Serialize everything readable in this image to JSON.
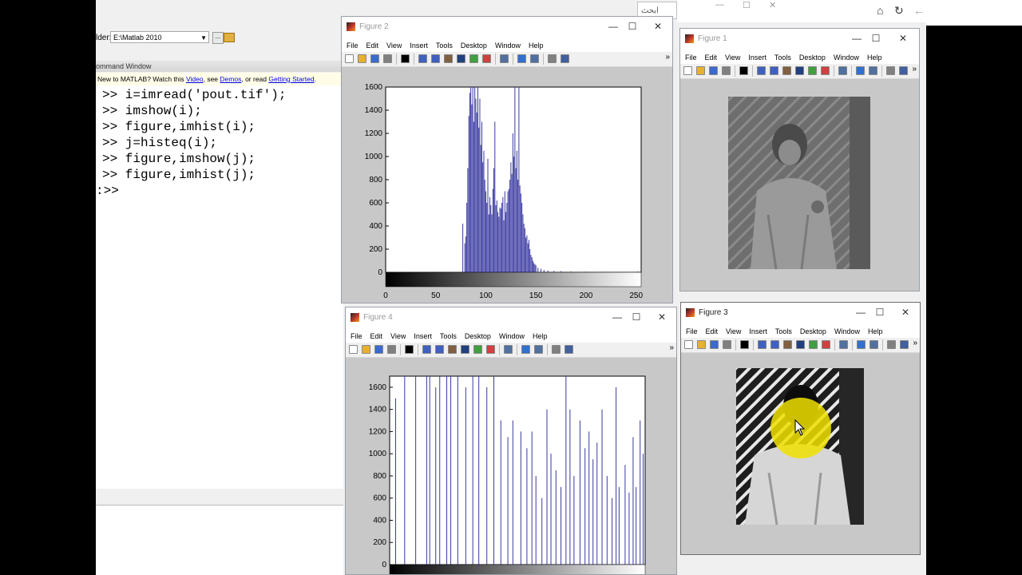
{
  "folder": {
    "label": "lder:",
    "path": "E:\\Matlab 2010",
    "browse": "..."
  },
  "command_window": {
    "title": "ommand Window",
    "banner": {
      "prefix": "New to MATLAB? Watch this ",
      "video": "Video",
      "mid1": ", see ",
      "demos": "Demos",
      "mid2": ", or read ",
      "getting_started": "Getting Started",
      "end": "."
    },
    "lines": [
      ">> i=imread('pout.tif');",
      ">> imshow(i);",
      ">> figure,imhist(i);",
      ">> j=histeq(i);",
      ">> figure,imshow(j);",
      ">> figure,imhist(j);",
      ":>>"
    ]
  },
  "browser": {
    "search_placeholder": "ابحث",
    "home_icon": "⌂",
    "refresh_icon": "↻",
    "back_icon": "←"
  },
  "menus": [
    "File",
    "Edit",
    "View",
    "Insert",
    "Tools",
    "Desktop",
    "Window",
    "Help"
  ],
  "window_controls": {
    "minimize": "—",
    "maximize": "☐",
    "close": "✕"
  },
  "figures": {
    "fig2": {
      "title": "Figure 2",
      "active": false
    },
    "fig1": {
      "title": "Figure 1",
      "active": false
    },
    "fig4": {
      "title": "Figure 4",
      "active": false
    },
    "fig3": {
      "title": "Figure 3",
      "active": true
    }
  },
  "accent": {
    "plot_line": "#3a3aa0",
    "cursor_highlight": "#f0e000"
  },
  "chart_data": [
    {
      "type": "bar",
      "title": "Figure 2",
      "xlabel": "",
      "ylabel": "",
      "xlim": [
        0,
        255
      ],
      "ylim": [
        0,
        1600
      ],
      "xticks": [
        0,
        50,
        100,
        150,
        200,
        250
      ],
      "yticks": [
        0,
        200,
        400,
        600,
        800,
        1000,
        1200,
        1400,
        1600
      ],
      "bins": [
        [
          77,
          420
        ],
        [
          79,
          250
        ],
        [
          80,
          310
        ],
        [
          81,
          600
        ],
        [
          82,
          900
        ],
        [
          83,
          1350
        ],
        [
          84,
          1550
        ],
        [
          85,
          1600
        ],
        [
          86,
          1450
        ],
        [
          87,
          1600
        ],
        [
          88,
          1300
        ],
        [
          89,
          1600
        ],
        [
          90,
          1500
        ],
        [
          91,
          1380
        ],
        [
          92,
          1600
        ],
        [
          93,
          1250
        ],
        [
          94,
          1500
        ],
        [
          95,
          1100
        ],
        [
          96,
          1300
        ],
        [
          97,
          950
        ],
        [
          98,
          1050
        ],
        [
          99,
          800
        ],
        [
          100,
          700
        ],
        [
          101,
          600
        ],
        [
          102,
          980
        ],
        [
          103,
          500
        ],
        [
          104,
          650
        ],
        [
          105,
          580
        ],
        [
          106,
          500
        ],
        [
          107,
          720
        ],
        [
          108,
          900
        ],
        [
          109,
          1300
        ],
        [
          110,
          580
        ],
        [
          111,
          620
        ],
        [
          112,
          520
        ],
        [
          113,
          480
        ],
        [
          114,
          560
        ],
        [
          115,
          550
        ],
        [
          116,
          600
        ],
        [
          117,
          650
        ],
        [
          118,
          450
        ],
        [
          119,
          700
        ],
        [
          120,
          520
        ],
        [
          121,
          600
        ],
        [
          122,
          700
        ],
        [
          123,
          720
        ],
        [
          124,
          800
        ],
        [
          125,
          950
        ],
        [
          126,
          850
        ],
        [
          127,
          1200
        ],
        [
          128,
          1000
        ],
        [
          129,
          1600
        ],
        [
          130,
          900
        ],
        [
          131,
          1050
        ],
        [
          132,
          800
        ],
        [
          133,
          1600
        ],
        [
          134,
          750
        ],
        [
          135,
          680
        ],
        [
          136,
          600
        ],
        [
          137,
          500
        ],
        [
          138,
          420
        ],
        [
          139,
          380
        ],
        [
          140,
          300
        ],
        [
          141,
          320
        ],
        [
          142,
          250
        ],
        [
          143,
          280
        ],
        [
          144,
          200
        ],
        [
          145,
          150
        ],
        [
          146,
          130
        ],
        [
          147,
          100
        ],
        [
          148,
          80
        ],
        [
          149,
          70
        ],
        [
          150,
          60
        ],
        [
          152,
          40
        ],
        [
          155,
          30
        ],
        [
          158,
          20
        ],
        [
          162,
          15
        ],
        [
          168,
          12
        ],
        [
          175,
          10
        ],
        [
          185,
          8
        ],
        [
          200,
          6
        ],
        [
          220,
          5
        ],
        [
          240,
          4
        ],
        [
          252,
          8
        ]
      ]
    },
    {
      "type": "bar",
      "title": "Figure 4",
      "xlabel": "",
      "ylabel": "",
      "xlim": [
        0,
        255
      ],
      "ylim": [
        0,
        1700
      ],
      "yticks": [
        0,
        200,
        400,
        600,
        800,
        1000,
        1200,
        1400,
        1600
      ],
      "bins": [
        [
          6,
          1500
        ],
        [
          15,
          1800
        ],
        [
          26,
          1800
        ],
        [
          37,
          1800
        ],
        [
          40,
          1700
        ],
        [
          46,
          1600
        ],
        [
          50,
          1800
        ],
        [
          57,
          1800
        ],
        [
          61,
          1700
        ],
        [
          68,
          1800
        ],
        [
          76,
          1600
        ],
        [
          83,
          1800
        ],
        [
          89,
          1800
        ],
        [
          97,
          1600
        ],
        [
          104,
          1700
        ],
        [
          111,
          1300
        ],
        [
          118,
          1150
        ],
        [
          123,
          1300
        ],
        [
          131,
          1200
        ],
        [
          137,
          1050
        ],
        [
          142,
          1200
        ],
        [
          146,
          800
        ],
        [
          152,
          600
        ],
        [
          157,
          1400
        ],
        [
          161,
          1000
        ],
        [
          166,
          850
        ],
        [
          171,
          700
        ],
        [
          176,
          1800
        ],
        [
          180,
          1400
        ],
        [
          184,
          800
        ],
        [
          190,
          1300
        ],
        [
          195,
          1050
        ],
        [
          199,
          1200
        ],
        [
          203,
          950
        ],
        [
          207,
          1100
        ],
        [
          212,
          1400
        ],
        [
          217,
          800
        ],
        [
          222,
          600
        ],
        [
          226,
          1600
        ],
        [
          229,
          700
        ],
        [
          235,
          900
        ],
        [
          239,
          650
        ],
        [
          243,
          1150
        ],
        [
          246,
          700
        ],
        [
          250,
          1300
        ],
        [
          253,
          1000
        ]
      ]
    }
  ]
}
